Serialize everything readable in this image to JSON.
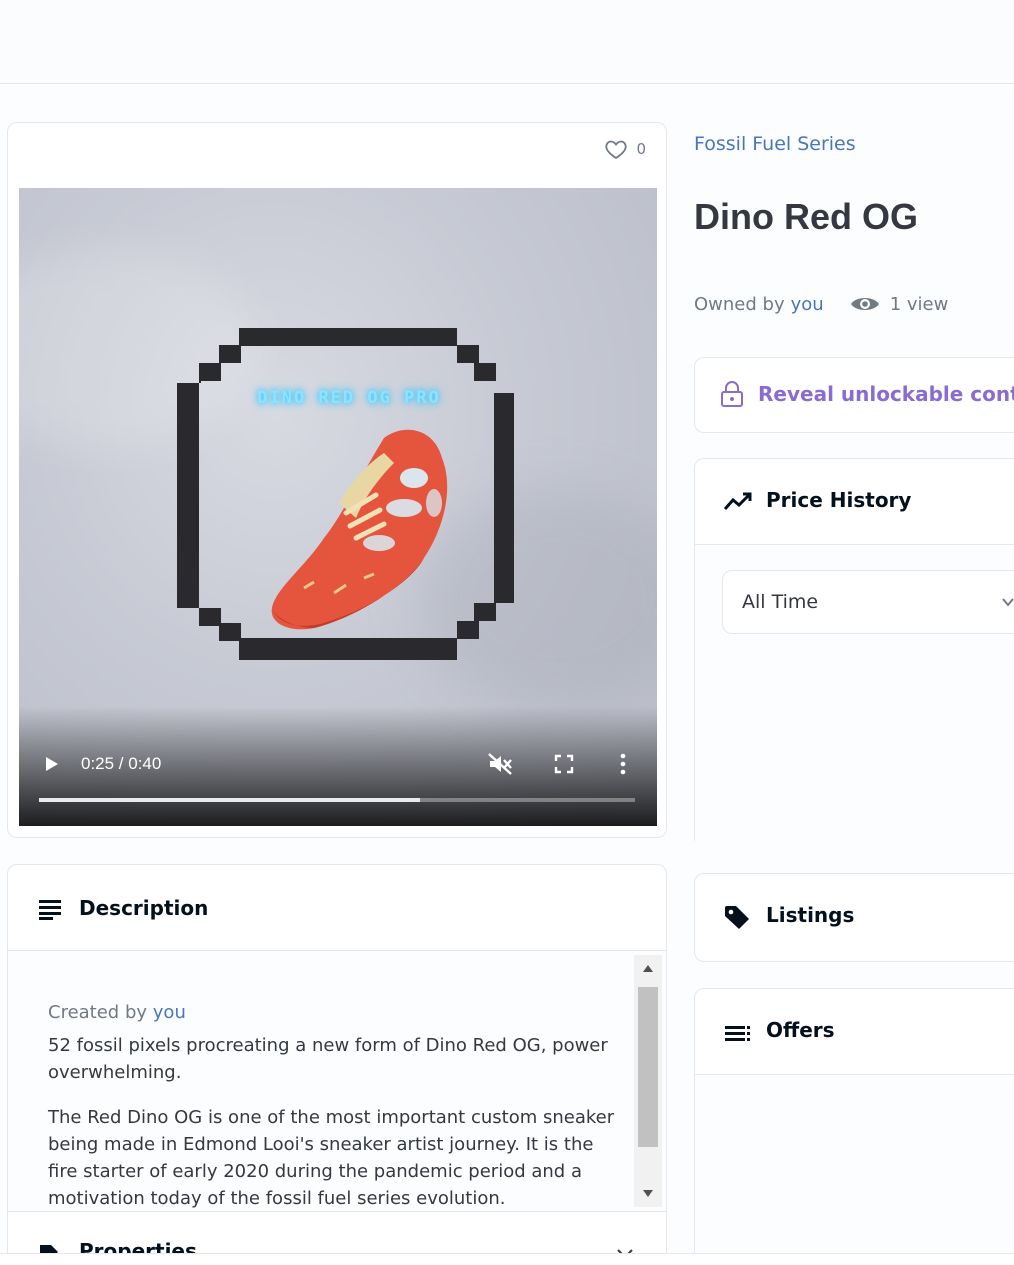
{
  "media": {
    "likes": "0",
    "video_overlay_text": "DINO RED OG PRO",
    "time": "0:25 / 0:40",
    "progress": 0.64
  },
  "item": {
    "collection": "Fossil Fuel Series",
    "title": "Dino Red OG",
    "owned_by_label": "Owned by",
    "owner": "you",
    "views": "1 view"
  },
  "reveal": {
    "label": "Reveal unlockable content"
  },
  "price_history": {
    "title": "Price History",
    "range": "All Time"
  },
  "listings": {
    "title": "Listings"
  },
  "offers": {
    "title": "Offers"
  },
  "description": {
    "title": "Description",
    "created_by_label": "Created by",
    "creator": "you",
    "paragraph1": "52 fossil pixels procreating a new form of Dino Red OG, power overwhelming.",
    "paragraph2": "The Red Dino OG is one of the most important custom sneaker being made in Edmond Looi's sneaker artist journey. It is the fire starter of early 2020 during the pandemic period and a motivation today of the fossil fuel series evolution."
  },
  "properties": {
    "title": "Properties"
  },
  "colors": {
    "link": "#4a76b8",
    "unlockable": "#8a6bd0",
    "text": "#353840",
    "muted": "#707a83"
  },
  "icons": [
    "heart-icon",
    "play-icon",
    "mute-icon",
    "fullscreen-icon",
    "more-vert-icon",
    "eye-icon",
    "lock-icon",
    "trending-icon",
    "chevron-down-icon",
    "tag-icon",
    "list-icon",
    "notes-icon",
    "properties-icon"
  ]
}
